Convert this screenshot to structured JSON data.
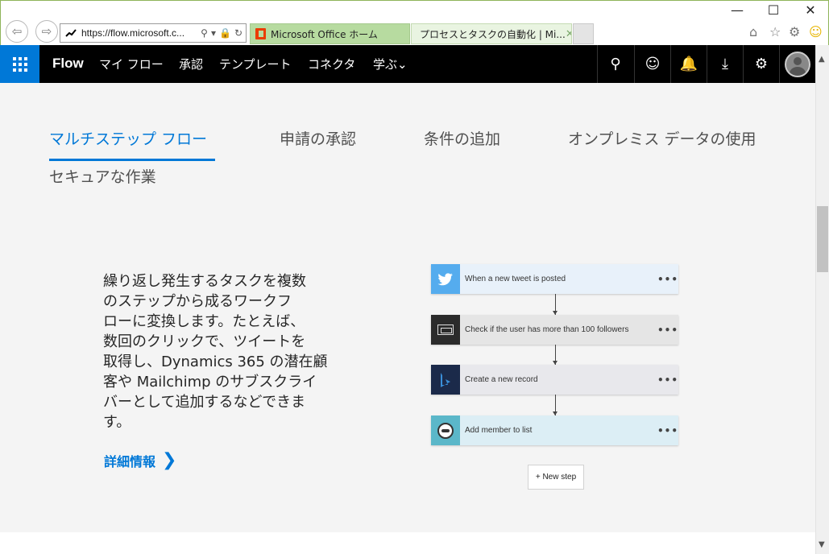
{
  "browser": {
    "back_icon": "back-arrow-icon",
    "forward_icon": "forward-arrow-icon",
    "address": "https://flow.microsoft.c...",
    "address_tools": [
      "⚲",
      "▾",
      "🔒",
      "↻"
    ],
    "tabs": [
      {
        "label": "Microsoft Office ホーム",
        "active": false
      },
      {
        "label": "プロセスとタスクの自動化 | Mi...",
        "active": true,
        "close": "✕"
      }
    ],
    "window_controls": {
      "minimize": "—",
      "maximize": "☐",
      "close": "✕"
    },
    "toolbar_icons": {
      "home": "⌂",
      "favorites": "☆",
      "settings": "⚙",
      "feedback": "☺"
    }
  },
  "app": {
    "brand": "Flow",
    "nav": {
      "my_flows": "マイ フロー",
      "approvals": "承認",
      "templates": "テンプレート",
      "connectors": "コネクタ",
      "learn": "学ぶ⌄"
    },
    "header_icons": {
      "search": "⚲",
      "feedback": "☺",
      "notifications": "🔔",
      "download": "⤓",
      "settings": "⚙"
    }
  },
  "feature_tabs": {
    "multistep": "マルチステップ フロー",
    "approvals": "申請の承認",
    "conditions": "条件の追加",
    "onprem": "オンプレミス データの使用",
    "secure": "セキュアな作業",
    "active": "multistep"
  },
  "description": {
    "lines": [
      "繰り返し発生するタスクを複数",
      "のステップから成るワークフ",
      "ローに変換します。たとえば、",
      "数回のクリックで、ツイートを",
      "取得し、Dynamics 365 の潜在顧",
      "客や Mailchimp のサブスクライ",
      "バーとして追加するなどできま",
      "す。"
    ],
    "more_link": "詳細情報",
    "more_chevron": "❯"
  },
  "flow_steps": [
    {
      "label": "When a new tweet is posted",
      "icon": "twitter-icon",
      "menu": "•••"
    },
    {
      "label": "Check if the user has more than 100 followers",
      "icon": "condition-icon",
      "menu": "•••"
    },
    {
      "label": "Create a new record",
      "icon": "dynamics-icon",
      "menu": "•••"
    },
    {
      "label": "Add member to list",
      "icon": "mailchimp-icon",
      "menu": "•••"
    }
  ],
  "new_step": "+ New step",
  "scrollbar": {
    "up": "▲",
    "down": "▼"
  },
  "colors": {
    "accent": "#0078d7",
    "header_bg": "#000000",
    "content_bg": "#f4f4f4"
  }
}
